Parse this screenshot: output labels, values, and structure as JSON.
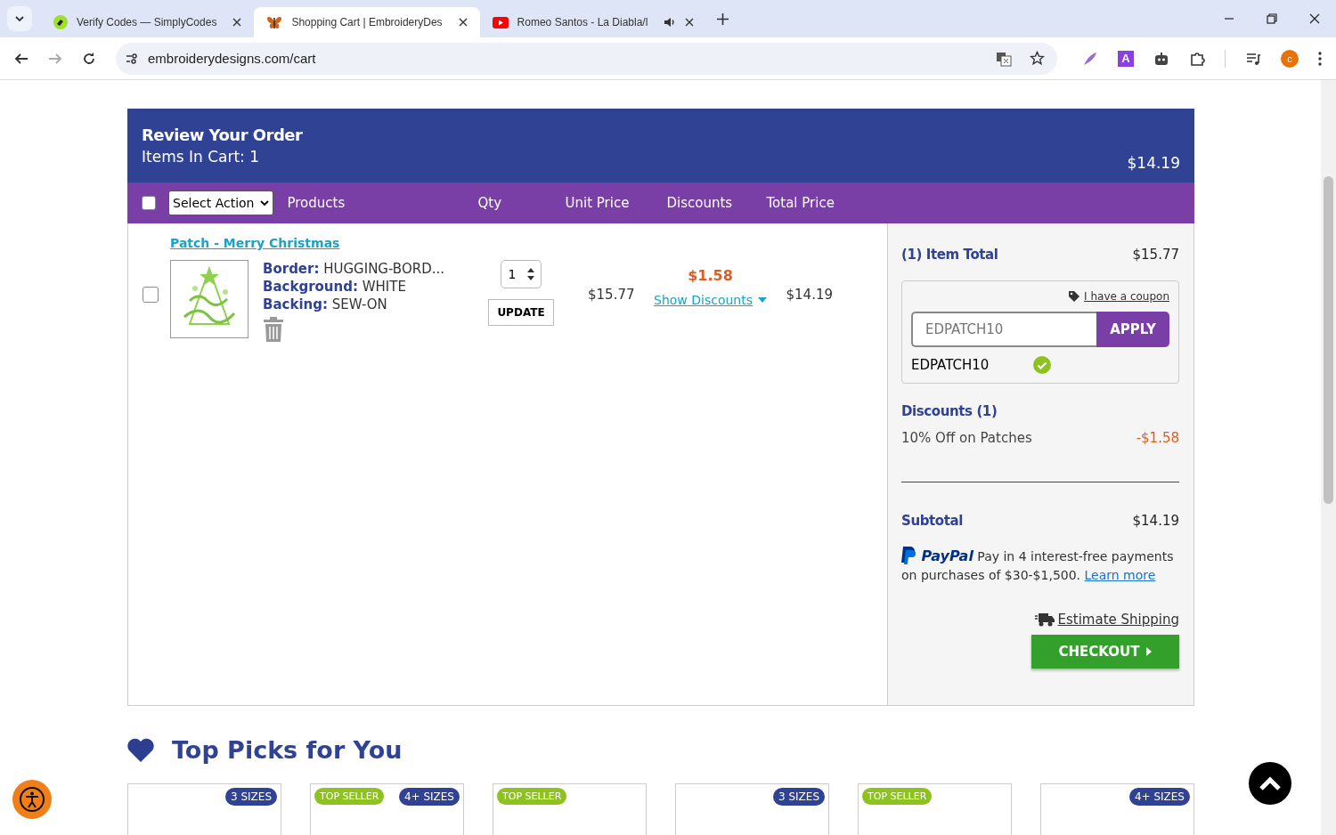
{
  "browser": {
    "tabs": [
      {
        "title": "Verify Codes — SimplyCodes",
        "selected": false,
        "audio": false,
        "kind": "simplycodes"
      },
      {
        "title": "Shopping Cart | EmbroideryDes",
        "selected": true,
        "audio": false,
        "kind": "butterfly"
      },
      {
        "title": "Romeo Santos - La Diabla/l",
        "selected": false,
        "audio": true,
        "kind": "video"
      }
    ],
    "url": "embroiderydesigns.com/cart",
    "profile_initial": "c",
    "extension_letter": "A"
  },
  "cart": {
    "title": "Review Your Order",
    "items_count": "Items In Cart: 1",
    "header_total": "$14.19",
    "action_select": "Select Action",
    "select_all_checked": false,
    "columns": [
      "Products",
      "Qty",
      "Unit Price",
      "Discounts",
      "Total Price"
    ],
    "items": [
      {
        "name": "Patch - Merry Christmas",
        "checked": false,
        "options": [
          {
            "label": "Border:",
            "value": "HUGGING-BORD..."
          },
          {
            "label": "Background:",
            "value": "WHITE"
          },
          {
            "label": "Backing:",
            "value": "SEW-ON"
          }
        ],
        "qty": "1",
        "update": "UPDATE",
        "unit_price": "$15.77",
        "discount": "$1.58",
        "show_discounts": "Show Discounts",
        "total": "$14.19"
      }
    ]
  },
  "summary": {
    "item_total_label": "(1) Item Total",
    "item_total": "$15.77",
    "coupon_link": "I have a coupon",
    "coupon_placeholder": "EDPATCH10",
    "apply": "APPLY",
    "applied_code": "EDPATCH10",
    "discounts_title": "Discounts (1)",
    "discounts": [
      {
        "label": "10% Off on Patches",
        "amount": "-$1.58"
      }
    ],
    "subtotal_label": "Subtotal",
    "subtotal": "$14.19",
    "paypal": {
      "brand": "PayPal",
      "text": "Pay in 4 interest-free payments on purchases of $30-$1,500.",
      "link": "Learn more"
    },
    "estimate_shipping": "Estimate Shipping",
    "checkout": "CHECKOUT"
  },
  "top_picks": {
    "title": "Top Picks for You",
    "cards": [
      {
        "badges": [
          {
            "kind": "sizes",
            "text": "3 SIZES"
          }
        ]
      },
      {
        "badges": [
          {
            "kind": "seller",
            "text": "TOP SELLER"
          },
          {
            "kind": "sizes",
            "text": "4+ SIZES"
          }
        ]
      },
      {
        "badges": [
          {
            "kind": "seller",
            "text": "TOP SELLER"
          }
        ]
      },
      {
        "badges": [
          {
            "kind": "sizes",
            "text": "3 SIZES"
          }
        ]
      },
      {
        "badges": [
          {
            "kind": "seller",
            "text": "TOP SELLER"
          }
        ]
      },
      {
        "badges": [
          {
            "kind": "sizes",
            "text": "4+ SIZES"
          }
        ]
      }
    ]
  }
}
